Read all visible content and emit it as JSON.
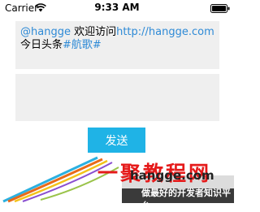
{
  "status_bar": {
    "carrier": "Carrier",
    "time": "9:33 AM"
  },
  "message": {
    "mention": "@hangge",
    "text": " 欢迎访问",
    "url": "http://hangge.com",
    "line2_text": "今日头条",
    "hashtag": "#航歌#"
  },
  "input": {
    "value": ""
  },
  "send_button": {
    "label": "发送"
  },
  "watermark": {
    "brand": "一聚教程网",
    "domain": "hangge.com",
    "tagline": "做最好的开发者知识平台"
  },
  "colors": {
    "link": "#2e8ad6",
    "button": "#1fb3e6",
    "box": "#efefef"
  }
}
